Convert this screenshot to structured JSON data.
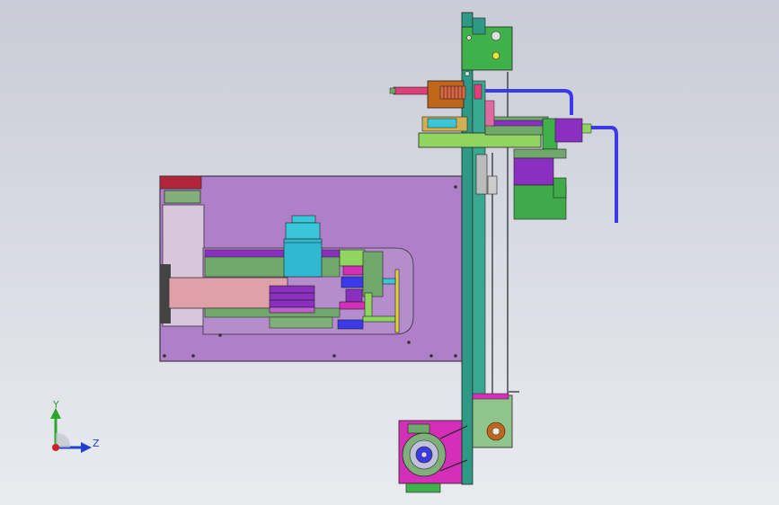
{
  "viewport": {
    "background_top": "#c9ccd6",
    "background_bottom": "#e9ebef"
  },
  "triad": {
    "y_label": "Y",
    "z_label": "Z",
    "y_color": "#2aa82a",
    "z_color": "#2040d0",
    "origin_color": "#d02020"
  },
  "model": {
    "icon": "cad-assembly-side-view",
    "colors": {
      "plate": "#b07fc9",
      "plate_window": "#d3c3d8",
      "red_block": "#b2243a",
      "green_part": "#6fa86a",
      "light_green": "#8fd55f",
      "cyan_cylinder": "#39c6d6",
      "teal_rail": "#2e9a86",
      "pink_slider": "#e0a0a8",
      "purple_block": "#8a2fbf",
      "blue_hose": "#3a3ae8",
      "magenta_bracket": "#d42fb8",
      "orange_block": "#c0661a",
      "yellow_rod": "#e0d040",
      "motor_green": "#3faa4a"
    }
  }
}
